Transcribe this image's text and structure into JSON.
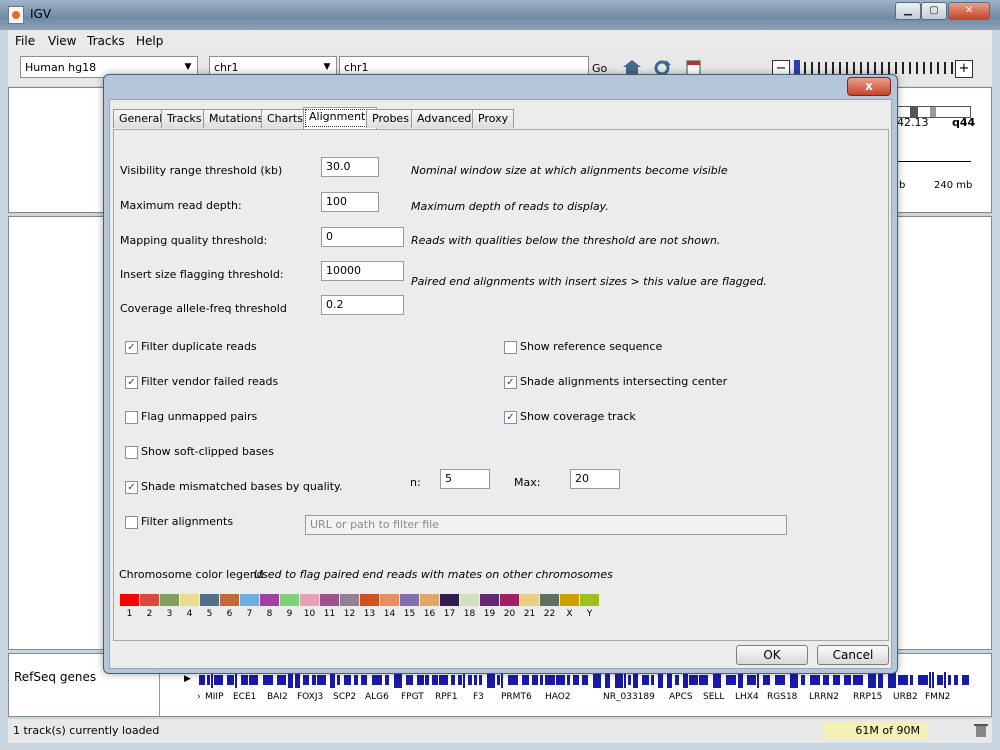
{
  "window": {
    "title": "IGV"
  },
  "menu": [
    "File",
    "View",
    "Tracks",
    "Help"
  ],
  "toolbar": {
    "genome": "Human hg18",
    "chromosome": "chr1",
    "locus": "chr1",
    "go_label": "Go",
    "zoom_minus": "−",
    "zoom_plus": "+"
  },
  "ruler": {
    "band_label": "42.13",
    "band_label2": "q44",
    "mb_label_left": "b",
    "mb_label": "240 mb"
  },
  "dialog": {
    "close_label": "x",
    "tabs": [
      "General",
      "Tracks",
      "Mutations",
      "Charts",
      "Alignments",
      "Probes",
      "Advanced",
      "Proxy"
    ],
    "active_tab": "Alignments",
    "fields": [
      {
        "label": "Visibility range threshold (kb)",
        "value": "30.0",
        "desc": "Nominal window size at which alignments become visible"
      },
      {
        "label": "Maximum read depth:",
        "value": "100",
        "desc": "Maximum depth of reads to display."
      },
      {
        "label": "Mapping quality threshold:",
        "value": "0",
        "desc": "Reads with qualities below the threshold are not shown."
      },
      {
        "label": "Insert size flagging threshold:",
        "value": "10000",
        "desc": "Paired end alignments with insert sizes > this value are flagged."
      },
      {
        "label": "Coverage allele-freq threshold",
        "value": "0.2",
        "desc": ""
      }
    ],
    "checkboxes_left": [
      {
        "label": "Filter duplicate reads",
        "checked": true
      },
      {
        "label": "Filter vendor failed reads",
        "checked": true
      },
      {
        "label": "Flag unmapped pairs",
        "checked": false
      },
      {
        "label": "Show soft-clipped bases",
        "checked": false
      },
      {
        "label": "Shade mismatched bases by quality.",
        "checked": true
      },
      {
        "label": "Filter alignments",
        "checked": false
      }
    ],
    "checkboxes_right": [
      {
        "label": "Show reference sequence",
        "checked": false
      },
      {
        "label": "Shade alignments intersecting center",
        "checked": true
      },
      {
        "label": "Show coverage track",
        "checked": true
      }
    ],
    "min_label": "n:",
    "min_value": "5",
    "max_label": "Max:",
    "max_value": "20",
    "filter_placeholder": "URL or path to filter file",
    "legend_label": "Chromosome color legend",
    "legend_desc": "Used to flag paired end reads with mates on other chromosomes",
    "legend": [
      {
        "n": "1",
        "color": "#ff0000"
      },
      {
        "n": "2",
        "color": "#d94a3c"
      },
      {
        "n": "3",
        "color": "#83a062"
      },
      {
        "n": "4",
        "color": "#eadc8c"
      },
      {
        "n": "5",
        "color": "#50708a"
      },
      {
        "n": "6",
        "color": "#c06a38"
      },
      {
        "n": "7",
        "color": "#6ab0e0"
      },
      {
        "n": "8",
        "color": "#a040a0"
      },
      {
        "n": "9",
        "color": "#7dd07a"
      },
      {
        "n": "10",
        "color": "#e8a0b8"
      },
      {
        "n": "11",
        "color": "#a0508a"
      },
      {
        "n": "12",
        "color": "#908090"
      },
      {
        "n": "13",
        "color": "#d05020"
      },
      {
        "n": "14",
        "color": "#e89060"
      },
      {
        "n": "15",
        "color": "#8070b0"
      },
      {
        "n": "16",
        "color": "#e0a868"
      },
      {
        "n": "17",
        "color": "#302050"
      },
      {
        "n": "18",
        "color": "#d0e0c0"
      },
      {
        "n": "19",
        "color": "#602870"
      },
      {
        "n": "20",
        "color": "#a02060"
      },
      {
        "n": "21",
        "color": "#e8d080"
      },
      {
        "n": "22",
        "color": "#607060"
      },
      {
        "n": "X",
        "color": "#d0a000"
      },
      {
        "n": "Y",
        "color": "#a0c020"
      }
    ],
    "ok_label": "OK",
    "cancel_label": "Cancel"
  },
  "tracks": {
    "refseq_name": "RefSeq genes",
    "genes": [
      "MIIP",
      "ECE1",
      "BAI2",
      "FOXJ3",
      "SCP2",
      "ALG6",
      "FPGT",
      "RPF1",
      "F3",
      "PRMT6",
      "HAO2",
      "NR_033189",
      "APCS",
      "SELL",
      "LHX4",
      "RGS18",
      "LRRN2",
      "RRP15",
      "URB2",
      "FMN2"
    ]
  },
  "status": {
    "message": "1 track(s) currently loaded",
    "memory": "61M of 90M"
  },
  "colors": {
    "gene_blue": "#1a1aa8",
    "checkmark": "#1b3f8b",
    "memory_bg": "#f4f0b8"
  }
}
